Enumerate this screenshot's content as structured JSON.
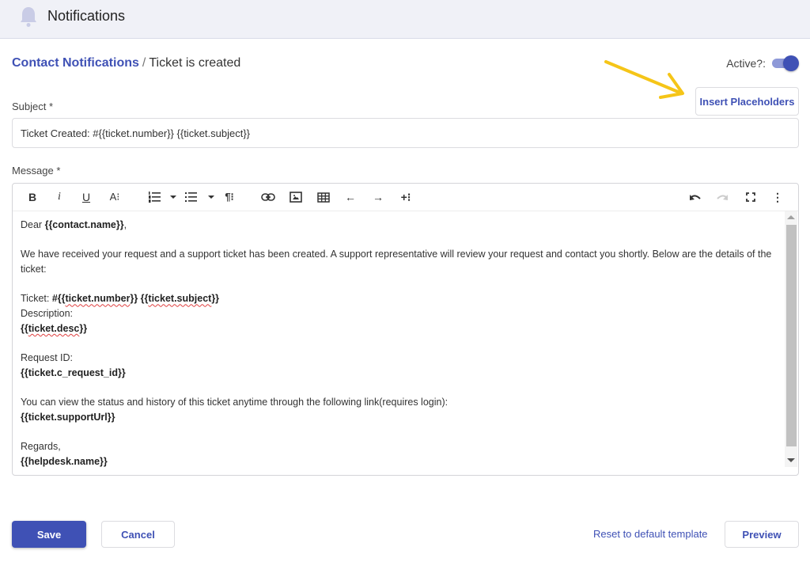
{
  "header": {
    "title": "Notifications",
    "icon": "bell-icon"
  },
  "breadcrumb": {
    "parent": "Contact Notifications",
    "separator": "/",
    "current": "Ticket is created"
  },
  "active": {
    "label": "Active?:",
    "value": true
  },
  "insert_placeholders_label": "Insert Placeholders",
  "subject": {
    "label": "Subject *",
    "value": "Ticket Created: #{{ticket.number}} {{ticket.subject}}"
  },
  "message": {
    "label": "Message *",
    "toolbar": {
      "bold": "B",
      "italic": "i",
      "underline": "U",
      "font_size": "A⁝",
      "ordered_list": "ordered-list-icon",
      "unordered_list": "unordered-list-icon",
      "paragraph": "¶⁝",
      "link": "link-icon",
      "image": "image-icon",
      "table": "table-icon",
      "outdent": "←",
      "indent": "→",
      "more_insert": "+⁝",
      "undo": "undo-icon",
      "redo": "redo-icon",
      "fullscreen": "fullscreen-icon",
      "more": "⋮"
    },
    "body": {
      "greeting_prefix": "Dear ",
      "greeting_placeholder": "{{contact.name}}",
      "greeting_suffix": ",",
      "intro": "We have received your request and a support ticket has been created. A support representative will review your request and contact you shortly. Below are the details of the ticket:",
      "ticket_label": "Ticket: ",
      "ticket_hash": "#{{",
      "ticket_number": "ticket.number",
      "ticket_mid": "}} {{",
      "ticket_subject": "ticket.subject",
      "ticket_end": "}}",
      "description_label": "Description:",
      "desc_open": "{{",
      "desc_value": "ticket.desc",
      "desc_close": "}}",
      "request_id_label": "Request ID:",
      "request_id_value": "{{ticket.c_request_id}}",
      "status_text": "You can view the status and history of this ticket anytime through the following link(requires login):",
      "support_url": "{{ticket.supportUrl}}",
      "regards": "Regards,",
      "helpdesk_name": "{{helpdesk.name}}"
    }
  },
  "footer": {
    "save": "Save",
    "cancel": "Cancel",
    "reset": "Reset to default template",
    "preview": "Preview"
  },
  "colors": {
    "accent": "#3f51b5",
    "toggle_track": "#8e99d8",
    "arrow": "#f5c518",
    "header_bg": "#f0f1f7"
  }
}
